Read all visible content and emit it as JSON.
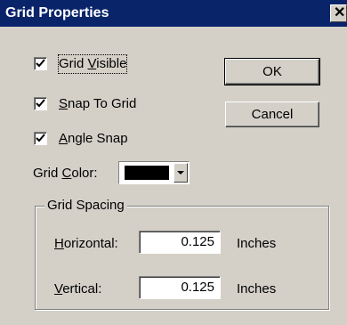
{
  "dialog": {
    "title": "Grid Properties",
    "close_glyph": "✕"
  },
  "checkboxes": [
    {
      "pre": "Grid ",
      "mnemonic": "V",
      "post": "isible",
      "checked": true
    },
    {
      "pre": "",
      "mnemonic": "S",
      "post": "nap To Grid",
      "checked": true
    },
    {
      "pre": "",
      "mnemonic": "A",
      "post": "ngle Snap",
      "checked": true
    }
  ],
  "buttons": {
    "ok_label": "OK",
    "cancel_label": "Cancel"
  },
  "grid_color": {
    "label_pre": "Grid ",
    "label_mnemonic": "C",
    "label_post": "olor:",
    "value": "#000000"
  },
  "spacing": {
    "group_title": "Grid Spacing",
    "horizontal": {
      "mnemonic": "H",
      "post": "orizontal:",
      "value": "0.125",
      "unit": "Inches"
    },
    "vertical": {
      "mnemonic": "V",
      "post": "ertical:",
      "value": "0.125",
      "unit": "Inches"
    }
  }
}
